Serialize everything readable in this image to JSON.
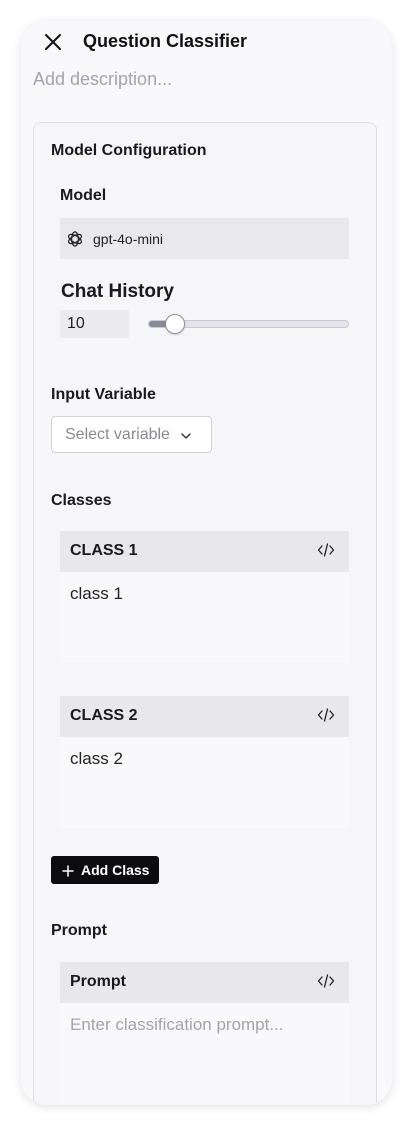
{
  "header": {
    "title": "Question Classifier",
    "description_placeholder": "Add description..."
  },
  "model_config": {
    "section_title": "Model Configuration",
    "model_label": "Model",
    "model_name": "gpt-4o-mini",
    "chat_history_label": "Chat History",
    "chat_history_value": "10",
    "chat_history_slider_fraction": 0.13
  },
  "input_variable": {
    "label": "Input Variable",
    "placeholder": "Select variable"
  },
  "classes": {
    "label": "Classes",
    "items": [
      {
        "title": "CLASS 1",
        "text": "class 1"
      },
      {
        "title": "CLASS 2",
        "text": "class 2"
      }
    ],
    "add_label": "Add Class"
  },
  "prompt": {
    "label": "Prompt",
    "card_title": "Prompt",
    "placeholder": "Enter classification prompt..."
  },
  "icons": {
    "close": "close-icon",
    "model": "openai-icon",
    "code": "code-icon",
    "chevron": "chevron-down-icon",
    "plus": "plus-icon"
  }
}
